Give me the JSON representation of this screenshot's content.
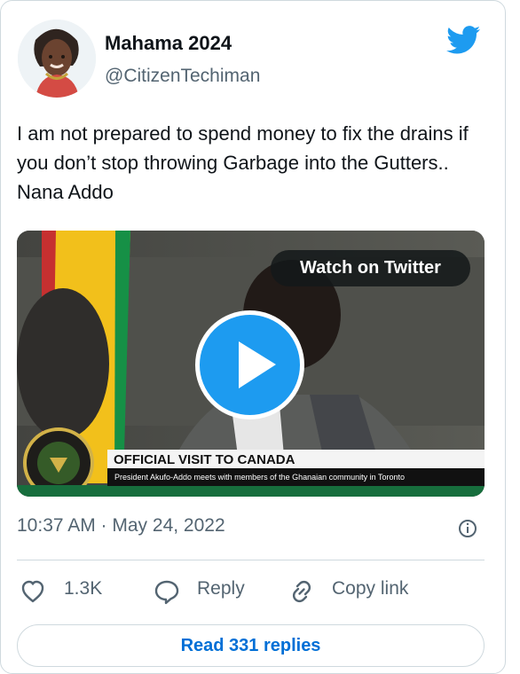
{
  "user": {
    "display_name": "Mahama 2024",
    "handle": "@CitizenTechiman"
  },
  "tweet": {
    "text": "I am not prepared to spend money to fix the drains if you don’t stop throwing Garbage into the Gutters.. Nana Addo",
    "timestamp": "10:37 AM · May 24, 2022"
  },
  "media": {
    "watch_label": "Watch on Twitter",
    "lower_third_title": "OFFICIAL VISIT TO CANADA",
    "lower_third_subtitle": "President Akufo-Addo meets with members of the Ghanaian community in Toronto"
  },
  "actions": {
    "likes": "1.3K",
    "reply": "Reply",
    "copy_link": "Copy link"
  },
  "footer": {
    "read_replies": "Read 331 replies"
  },
  "icons": [
    "twitter-bird-icon",
    "play-icon",
    "info-icon",
    "heart-icon",
    "reply-icon",
    "link-icon"
  ],
  "colors": {
    "twitter_blue": "#1d9bf0",
    "link_blue": "#006fd6",
    "gray_text": "#536471",
    "border": "#cfd9de"
  }
}
